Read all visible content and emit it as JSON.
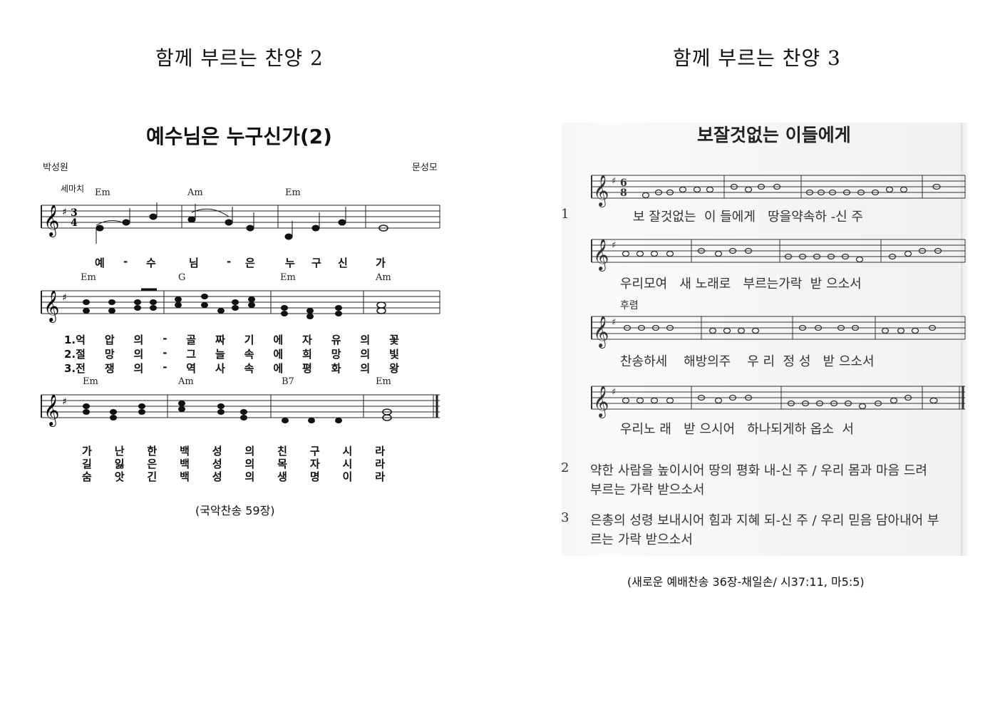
{
  "left": {
    "heading": "함께 부르는 찬양 2",
    "title": "예수님은 누구신가(2)",
    "lyricist": "박성원",
    "composer": "문성모",
    "rhythm": "세마치",
    "system1": {
      "chords": [
        "Em",
        "Am",
        "Em"
      ],
      "lyrics": [
        "예",
        "-",
        "수",
        "님",
        "-",
        "은",
        "누",
        "구",
        "신",
        "가"
      ]
    },
    "system2": {
      "chords": [
        "Em",
        "G",
        "Em",
        "Am"
      ],
      "verses": [
        [
          "1.억",
          "압",
          "의",
          "-",
          "골",
          "짜",
          "기",
          "에",
          "자",
          "유",
          "의",
          "꽃"
        ],
        [
          "2.절",
          "망",
          "의",
          "-",
          "그",
          "늘",
          "속",
          "에",
          "희",
          "망",
          "의",
          "빛"
        ],
        [
          "3.전",
          "쟁",
          "의",
          "-",
          "역",
          "사",
          "속",
          "에",
          "평",
          "화",
          "의",
          "왕"
        ]
      ]
    },
    "system3": {
      "chords": [
        "Em",
        "Am",
        "B7",
        "Em"
      ],
      "verses": [
        [
          "가",
          "난",
          "한",
          "백",
          "성",
          "의",
          "친",
          "구",
          "시",
          "라"
        ],
        [
          "길",
          "잃",
          "은",
          "백",
          "성",
          "의",
          "목",
          "자",
          "시",
          "라"
        ],
        [
          "숨",
          "앗",
          "긴",
          "백",
          "성",
          "의",
          "생",
          "명",
          "이",
          "라"
        ]
      ]
    },
    "caption": "(국악찬송 59장)"
  },
  "right": {
    "heading": "함께 부르는 찬양 3",
    "title": "보잘것없는 이들에게",
    "verse_number_1": "1",
    "systems": [
      {
        "lyrics": "보 잘것없는  이 들에게   땅을약속하 -신 주"
      },
      {
        "lyrics": "우리모여   새 노래로   부르는가락  받 으소서"
      },
      {
        "label": "후렴",
        "lyrics": "찬송하세    해방의주    우 리  정 성   받 으소서"
      },
      {
        "lyrics": "우리노 래   받 으시어   하나되게하 옵소  서"
      }
    ],
    "verses": [
      {
        "num": "2",
        "line1": "약한 사람을 높이시어 땅의 평화 내-신 주 / 우리 몸과 마음 드려",
        "line2": "부르는 가락 받으소서"
      },
      {
        "num": "3",
        "line1": "은총의 성령 보내시어 힘과 지혜 되-신 주 / 우리 믿음 담아내어 부",
        "line2": "르는 가락 받으소서"
      }
    ],
    "caption": "(새로운 예배찬송 36장-채일손/ 시37:11, 마5:5)"
  }
}
